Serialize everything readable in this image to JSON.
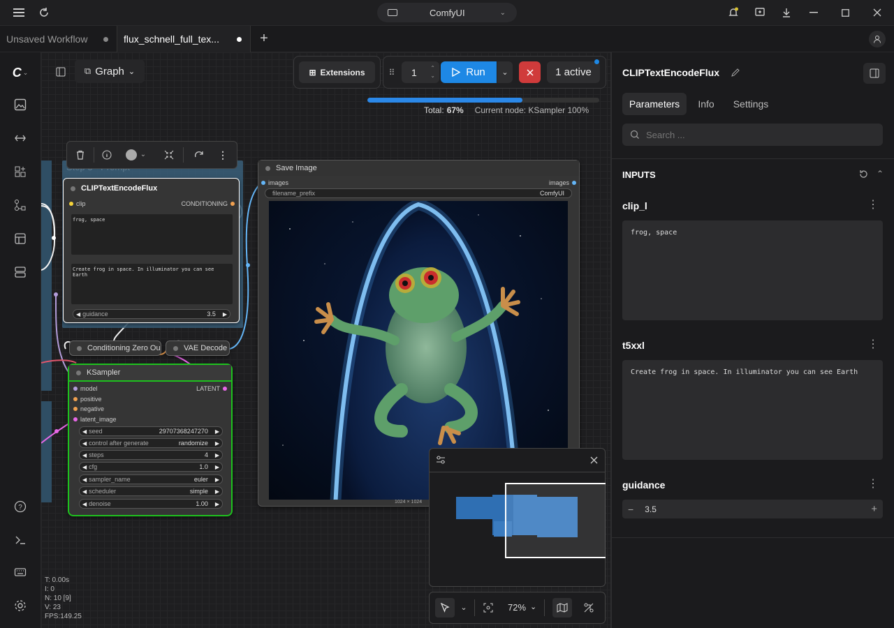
{
  "app": {
    "title": "ComfyUI"
  },
  "tabs": [
    {
      "label": "Unsaved Workflow"
    },
    {
      "label": "flux_schnell_full_tex..."
    }
  ],
  "toolbar": {
    "graph_label": "Graph",
    "extensions_label": "Extensions",
    "queue_count": "1",
    "run_label": "Run",
    "active_label": "1 active"
  },
  "progress": {
    "total_label": "Total:",
    "total_value": "67%",
    "current_node": "Current node: KSampler 100%",
    "fraction": 0.67
  },
  "nodes": {
    "group_title": "Step 3 - Prompt",
    "clip": {
      "title": "CLIPTextEncodeFlux",
      "in": "clip",
      "out": "CONDITIONING",
      "text1": "frog, space",
      "text2": "Create frog in space. In illuminator you can see Earth",
      "guidance_label": "guidance",
      "guidance_value": "3.5"
    },
    "cond_zero": {
      "title": "Conditioning Zero Ou"
    },
    "vae": {
      "title": "VAE Decode"
    },
    "ksampler": {
      "title": "KSampler",
      "out": "LATENT",
      "inputs": [
        "model",
        "positive",
        "negative",
        "latent_image"
      ],
      "widgets": [
        {
          "label": "seed",
          "value": "29707368247270"
        },
        {
          "label": "control after generate",
          "value": "randomize"
        },
        {
          "label": "steps",
          "value": "4"
        },
        {
          "label": "cfg",
          "value": "1.0"
        },
        {
          "label": "sampler_name",
          "value": "euler"
        },
        {
          "label": "scheduler",
          "value": "simple"
        },
        {
          "label": "denoise",
          "value": "1.00"
        }
      ]
    },
    "save": {
      "title": "Save Image",
      "in": "images",
      "out": "images",
      "prefix_label": "filename_prefix",
      "prefix_value": "ComfyUI",
      "dims": "1024 × 1024"
    }
  },
  "stats": {
    "t": "T: 0.00s",
    "i": "I: 0",
    "n": "N: 10 [9]",
    "v": "V: 23",
    "fps": "FPS:149.25"
  },
  "bottom": {
    "zoom": "72%"
  },
  "panel": {
    "title": "CLIPTextEncodeFlux",
    "tabs": [
      "Parameters",
      "Info",
      "Settings"
    ],
    "search_placeholder": "Search ...",
    "section": "INPUTS",
    "clip_l_label": "clip_l",
    "clip_l_value": "frog, space",
    "t5_label": "t5xxl",
    "t5_value": "Create frog in space. In illuminator you can see Earth",
    "guidance_label": "guidance",
    "guidance_value": "3.5"
  },
  "colors": {
    "accent": "#2b88e8",
    "run": "#1e88e5",
    "cancel": "#d03b3b",
    "selected_border": "#1ec21e",
    "group": "#3a5f7a"
  }
}
